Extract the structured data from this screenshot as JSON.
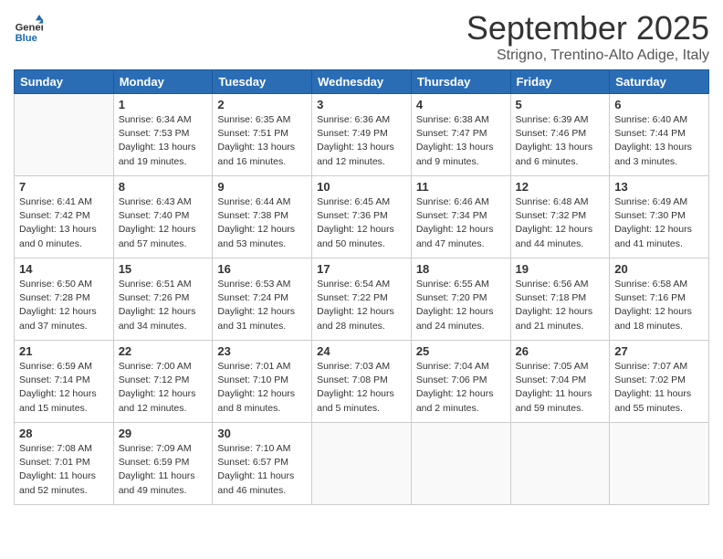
{
  "header": {
    "logo_text_general": "General",
    "logo_text_blue": "Blue",
    "month": "September 2025",
    "location": "Strigno, Trentino-Alto Adige, Italy"
  },
  "days_of_week": [
    "Sunday",
    "Monday",
    "Tuesday",
    "Wednesday",
    "Thursday",
    "Friday",
    "Saturday"
  ],
  "weeks": [
    [
      {
        "day": "",
        "info": ""
      },
      {
        "day": "1",
        "info": "Sunrise: 6:34 AM\nSunset: 7:53 PM\nDaylight: 13 hours\nand 19 minutes."
      },
      {
        "day": "2",
        "info": "Sunrise: 6:35 AM\nSunset: 7:51 PM\nDaylight: 13 hours\nand 16 minutes."
      },
      {
        "day": "3",
        "info": "Sunrise: 6:36 AM\nSunset: 7:49 PM\nDaylight: 13 hours\nand 12 minutes."
      },
      {
        "day": "4",
        "info": "Sunrise: 6:38 AM\nSunset: 7:47 PM\nDaylight: 13 hours\nand 9 minutes."
      },
      {
        "day": "5",
        "info": "Sunrise: 6:39 AM\nSunset: 7:46 PM\nDaylight: 13 hours\nand 6 minutes."
      },
      {
        "day": "6",
        "info": "Sunrise: 6:40 AM\nSunset: 7:44 PM\nDaylight: 13 hours\nand 3 minutes."
      }
    ],
    [
      {
        "day": "7",
        "info": "Sunrise: 6:41 AM\nSunset: 7:42 PM\nDaylight: 13 hours\nand 0 minutes."
      },
      {
        "day": "8",
        "info": "Sunrise: 6:43 AM\nSunset: 7:40 PM\nDaylight: 12 hours\nand 57 minutes."
      },
      {
        "day": "9",
        "info": "Sunrise: 6:44 AM\nSunset: 7:38 PM\nDaylight: 12 hours\nand 53 minutes."
      },
      {
        "day": "10",
        "info": "Sunrise: 6:45 AM\nSunset: 7:36 PM\nDaylight: 12 hours\nand 50 minutes."
      },
      {
        "day": "11",
        "info": "Sunrise: 6:46 AM\nSunset: 7:34 PM\nDaylight: 12 hours\nand 47 minutes."
      },
      {
        "day": "12",
        "info": "Sunrise: 6:48 AM\nSunset: 7:32 PM\nDaylight: 12 hours\nand 44 minutes."
      },
      {
        "day": "13",
        "info": "Sunrise: 6:49 AM\nSunset: 7:30 PM\nDaylight: 12 hours\nand 41 minutes."
      }
    ],
    [
      {
        "day": "14",
        "info": "Sunrise: 6:50 AM\nSunset: 7:28 PM\nDaylight: 12 hours\nand 37 minutes."
      },
      {
        "day": "15",
        "info": "Sunrise: 6:51 AM\nSunset: 7:26 PM\nDaylight: 12 hours\nand 34 minutes."
      },
      {
        "day": "16",
        "info": "Sunrise: 6:53 AM\nSunset: 7:24 PM\nDaylight: 12 hours\nand 31 minutes."
      },
      {
        "day": "17",
        "info": "Sunrise: 6:54 AM\nSunset: 7:22 PM\nDaylight: 12 hours\nand 28 minutes."
      },
      {
        "day": "18",
        "info": "Sunrise: 6:55 AM\nSunset: 7:20 PM\nDaylight: 12 hours\nand 24 minutes."
      },
      {
        "day": "19",
        "info": "Sunrise: 6:56 AM\nSunset: 7:18 PM\nDaylight: 12 hours\nand 21 minutes."
      },
      {
        "day": "20",
        "info": "Sunrise: 6:58 AM\nSunset: 7:16 PM\nDaylight: 12 hours\nand 18 minutes."
      }
    ],
    [
      {
        "day": "21",
        "info": "Sunrise: 6:59 AM\nSunset: 7:14 PM\nDaylight: 12 hours\nand 15 minutes."
      },
      {
        "day": "22",
        "info": "Sunrise: 7:00 AM\nSunset: 7:12 PM\nDaylight: 12 hours\nand 12 minutes."
      },
      {
        "day": "23",
        "info": "Sunrise: 7:01 AM\nSunset: 7:10 PM\nDaylight: 12 hours\nand 8 minutes."
      },
      {
        "day": "24",
        "info": "Sunrise: 7:03 AM\nSunset: 7:08 PM\nDaylight: 12 hours\nand 5 minutes."
      },
      {
        "day": "25",
        "info": "Sunrise: 7:04 AM\nSunset: 7:06 PM\nDaylight: 12 hours\nand 2 minutes."
      },
      {
        "day": "26",
        "info": "Sunrise: 7:05 AM\nSunset: 7:04 PM\nDaylight: 11 hours\nand 59 minutes."
      },
      {
        "day": "27",
        "info": "Sunrise: 7:07 AM\nSunset: 7:02 PM\nDaylight: 11 hours\nand 55 minutes."
      }
    ],
    [
      {
        "day": "28",
        "info": "Sunrise: 7:08 AM\nSunset: 7:01 PM\nDaylight: 11 hours\nand 52 minutes."
      },
      {
        "day": "29",
        "info": "Sunrise: 7:09 AM\nSunset: 6:59 PM\nDaylight: 11 hours\nand 49 minutes."
      },
      {
        "day": "30",
        "info": "Sunrise: 7:10 AM\nSunset: 6:57 PM\nDaylight: 11 hours\nand 46 minutes."
      },
      {
        "day": "",
        "info": ""
      },
      {
        "day": "",
        "info": ""
      },
      {
        "day": "",
        "info": ""
      },
      {
        "day": "",
        "info": ""
      }
    ]
  ]
}
